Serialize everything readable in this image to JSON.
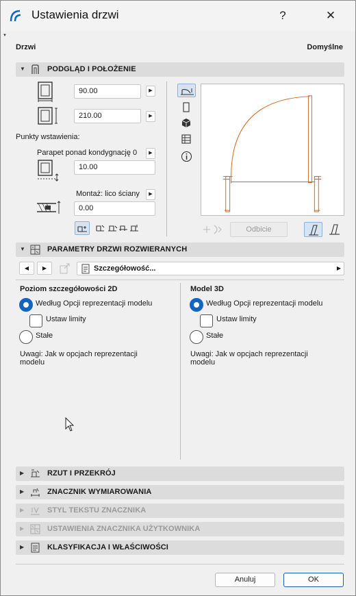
{
  "window": {
    "title": "Ustawienia drzwi",
    "help": "?",
    "close": "✕"
  },
  "header": {
    "left": "Drzwi",
    "right": "Domyślne"
  },
  "sections": {
    "preview_position": "PODGLĄD I POŁOŻENIE",
    "door_params": "PARAMETRY DRZWI ROZWIERANYCH",
    "plan_section": "RZUT I PRZEKRÓJ",
    "dimension_marker": "ZNACZNIK WYMIAROWANIA",
    "marker_text_style": "STYL TEKSTU ZNACZNIKA",
    "custom_marker": "USTAWIENIA ZNACZNIKA UŻYTKOWNIKA",
    "classification": "KLASYFIKACJA I WŁAŚCIWOŚCI"
  },
  "position": {
    "width_value": "90.00",
    "height_value": "210.00",
    "anchor_points_label": "Punkty wstawienia:",
    "sill_label": "Parapet ponad kondygnację 0",
    "sill_value": "10.00",
    "mount_label": "Montaż: lico ściany",
    "mount_value": "0.00",
    "mirror_button": "Odbicie"
  },
  "params": {
    "dropdown_label": "Szczegółowość...",
    "left": {
      "title": "Poziom szczegółowości 2D",
      "opt_model": "Według Opcji reprezentacji modelu",
      "opt_limits": "Ustaw limity",
      "opt_fixed": "Stałe",
      "note_line1": "Uwagi: Jak w opcjach reprezentacji",
      "note_line2": "modelu"
    },
    "right": {
      "title": "Model 3D",
      "opt_model": "Według Opcji reprezentacji modelu",
      "opt_limits": "Ustaw limity",
      "opt_fixed": "Stałe",
      "note_line1": "Uwagi: Jak w opcjach reprezentacji",
      "note_line2": "modelu"
    }
  },
  "buttons": {
    "cancel": "Anuluj",
    "ok": "OK"
  },
  "colors": {
    "accent": "#1465c0",
    "door_line": "#d2691e",
    "section_bg": "#dcdcdc"
  }
}
